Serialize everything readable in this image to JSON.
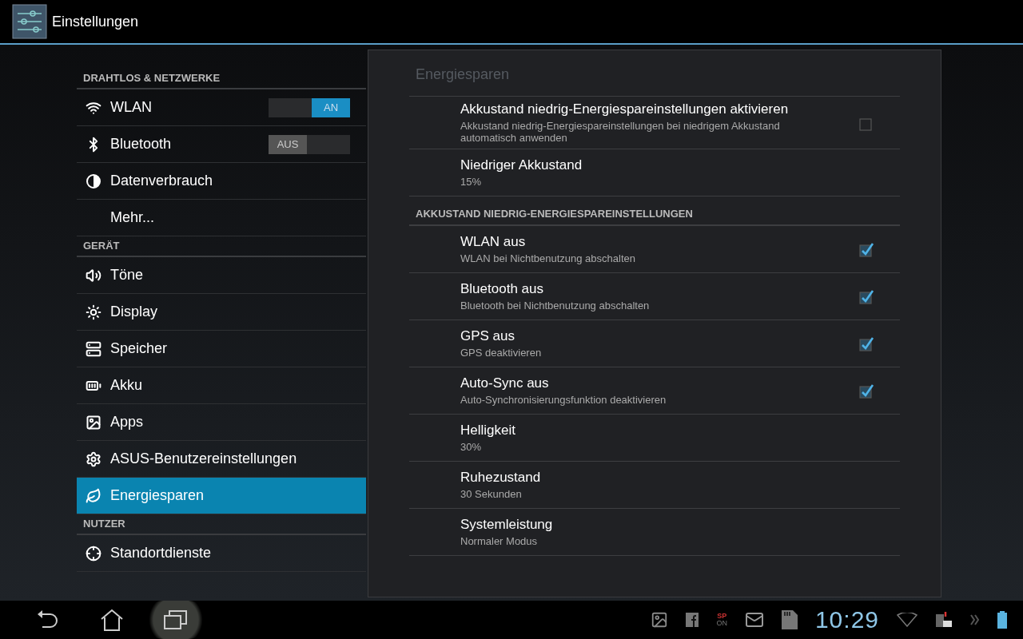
{
  "action_bar": {
    "title": "Einstellungen"
  },
  "sidebar": {
    "sections": [
      {
        "header": "DRAHTLOS & NETZWERKE",
        "items": [
          {
            "label": "WLAN",
            "selected": false,
            "toggle": {
              "label": "AN",
              "on": true
            }
          },
          {
            "label": "Bluetooth",
            "selected": false,
            "toggle": {
              "label": "AUS",
              "on": false
            }
          },
          {
            "label": "Datenverbrauch",
            "selected": false
          },
          {
            "label": "Mehr...",
            "selected": false
          }
        ]
      },
      {
        "header": "GERÄT",
        "items": [
          {
            "label": "Töne",
            "selected": false
          },
          {
            "label": "Display",
            "selected": false
          },
          {
            "label": "Speicher",
            "selected": false
          },
          {
            "label": "Akku",
            "selected": false
          },
          {
            "label": "Apps",
            "selected": false
          },
          {
            "label": "ASUS-Benutzereinstellungen",
            "selected": false
          },
          {
            "label": "Energiesparen",
            "selected": true
          }
        ]
      },
      {
        "header": "NUTZER",
        "items": [
          {
            "label": "Standortdienste",
            "selected": false
          }
        ]
      }
    ]
  },
  "panel": {
    "title": "Energiesparen",
    "items": [
      {
        "kind": "checkbox",
        "title": "Akkustand niedrig-Energiespareinstellungen aktivieren",
        "summary": "Akkustand niedrig-Energiespareinstellungen bei niedrigem Akkustand automatisch anwenden",
        "checked": false
      },
      {
        "kind": "value",
        "title": "Niedriger Akkustand",
        "summary": "15%"
      },
      {
        "kind": "header",
        "title": "AKKUSTAND NIEDRIG-ENERGIESPAREINSTELLUNGEN"
      },
      {
        "kind": "checkbox",
        "title": "WLAN aus",
        "summary": "WLAN bei Nichtbenutzung abschalten",
        "checked": true
      },
      {
        "kind": "checkbox",
        "title": "Bluetooth aus",
        "summary": "Bluetooth bei Nichtbenutzung abschalten",
        "checked": true
      },
      {
        "kind": "checkbox",
        "title": "GPS aus",
        "summary": "GPS deaktivieren",
        "checked": true
      },
      {
        "kind": "checkbox",
        "title": "Auto-Sync aus",
        "summary": "Auto-Synchronisierungsfunktion deaktivieren",
        "checked": true
      },
      {
        "kind": "value",
        "title": "Helligkeit",
        "summary": "30%"
      },
      {
        "kind": "value",
        "title": "Ruhezustand",
        "summary": "30 Sekunden"
      },
      {
        "kind": "value",
        "title": "Systemleistung",
        "summary": "Normaler Modus"
      }
    ]
  },
  "nav_bar": {
    "buttons": [
      {
        "pressed": false
      },
      {
        "pressed": false
      },
      {
        "pressed": true
      }
    ],
    "sp_badge": [
      "SP",
      "ON"
    ],
    "clock": "10:29"
  }
}
